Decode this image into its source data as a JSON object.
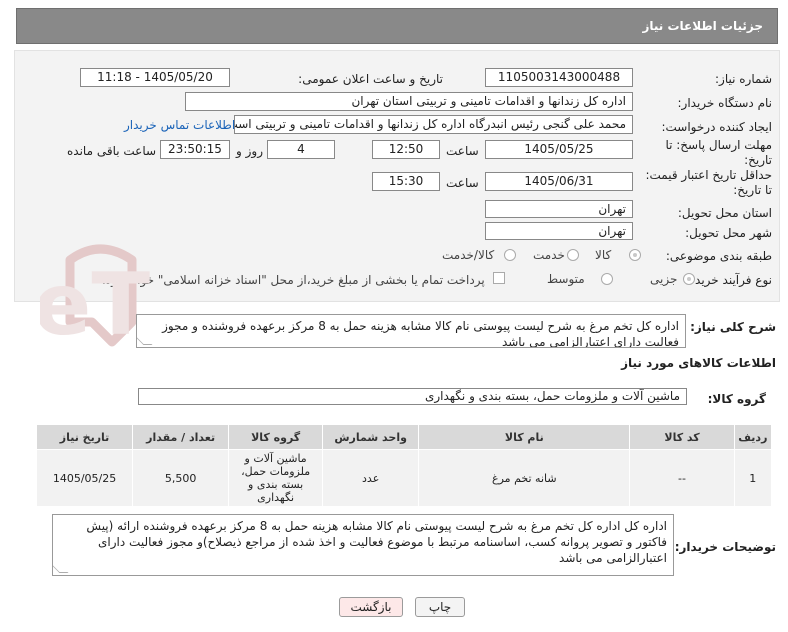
{
  "header": {
    "title": "جزئیات اطلاعات نیاز"
  },
  "form": {
    "need_number": {
      "label": "شماره نیاز:",
      "value": "1105003143000488"
    },
    "announce_datetime": {
      "label": "تاریخ و ساعت اعلان عمومی:",
      "value": "1405/05/20 - 11:18"
    },
    "buyer_org": {
      "label": "نام دستگاه خریدار:",
      "value": "اداره کل زندانها و اقدامات تامینی و تربیتی استان تهران"
    },
    "requester": {
      "label": "ایجاد کننده درخواست:",
      "value": "محمد علی گنجی رئیس انبدرگاه  اداره کل زندانها و اقدامات تامینی و تربیتی است",
      "contact_link": "اطلاعات تماس خریدار"
    },
    "reply_deadline": {
      "label_line1": "مهلت ارسال پاسخ: تا",
      "label_line2": "تاریخ:",
      "date": "1405/05/25",
      "time_label": "ساعت",
      "time": "12:50",
      "days": "4",
      "days_label": "روز و",
      "remaining_time": "23:50:15",
      "remaining_label": "ساعت باقی مانده"
    },
    "price_validity": {
      "label_line1": "حداقل تاریخ اعتبار قیمت:",
      "label_line2": "تا تاریخ:",
      "date": "1405/06/31",
      "time_label": "ساعت",
      "time": "15:30"
    },
    "delivery_province": {
      "label": "استان محل تحویل:",
      "value": "تهران"
    },
    "delivery_city": {
      "label": "شهر محل تحویل:",
      "value": "تهران"
    },
    "category": {
      "label": "طبقه بندی موضوعی:",
      "options": [
        "کالا",
        "خدمت",
        "کالا/خدمت"
      ],
      "selected": "کالا"
    },
    "purchase_process": {
      "label": "نوع فرآیند خرید :",
      "options": [
        "جزیی",
        "متوسط"
      ],
      "note": "پرداخت تمام یا بخشی از مبلغ خرید،از محل \"اسناد خزانه اسلامی\" خواهد بود."
    }
  },
  "general_description": {
    "label": "شرح کلی نیاز:",
    "text": "اداره کل تخم مرغ به شرح لیست پیوستی نام کالا مشابه هزینه حمل به 8 مرکز برعهده فروشنده و مجوز فعالیت دارای اعتبارالزامی می باشد"
  },
  "goods_section": {
    "title": "اطلاعات کالاهای مورد نیاز",
    "group_label": "گروه کالا:",
    "group_value": "ماشین آلات و ملزومات حمل، بسته بندی و نگهداری"
  },
  "table": {
    "headers": [
      "ردیف",
      "کد کالا",
      "نام کالا",
      "واحد شمارش",
      "گروه کالا",
      "تعداد / مقدار",
      "تاریخ نیاز"
    ],
    "rows": [
      {
        "row": "1",
        "code": "--",
        "name": "شانه تخم مرغ",
        "unit": "عدد",
        "group": "ماشین آلات و ملزومات حمل، بسته بندی و نگهداری",
        "quantity": "5,500",
        "date": "1405/05/25"
      }
    ]
  },
  "buyer_notes": {
    "label": "توضیحات خریدار:",
    "text": "اداره کل اداره کل تخم مرغ به شرح لیست پیوستی نام کالا مشابه هزینه حمل به 8 مرکز برعهده فروشنده ارائه (پیش فاکتور و تصویر پروانه کسب، اساسنامه مرتبط با موضوع فعالیت و اخذ شده از مراجع ذیصلاح)و مجوز فعالیت دارای اعتبارالزامی می باشد"
  },
  "buttons": {
    "print": "چاپ",
    "back": "بازگشت"
  },
  "watermark": {
    "text": "AriaTender.neT"
  },
  "colors": {
    "header_bg": "#898989",
    "link": "#1a63b8",
    "back_button_bg": "#fde8e8"
  }
}
